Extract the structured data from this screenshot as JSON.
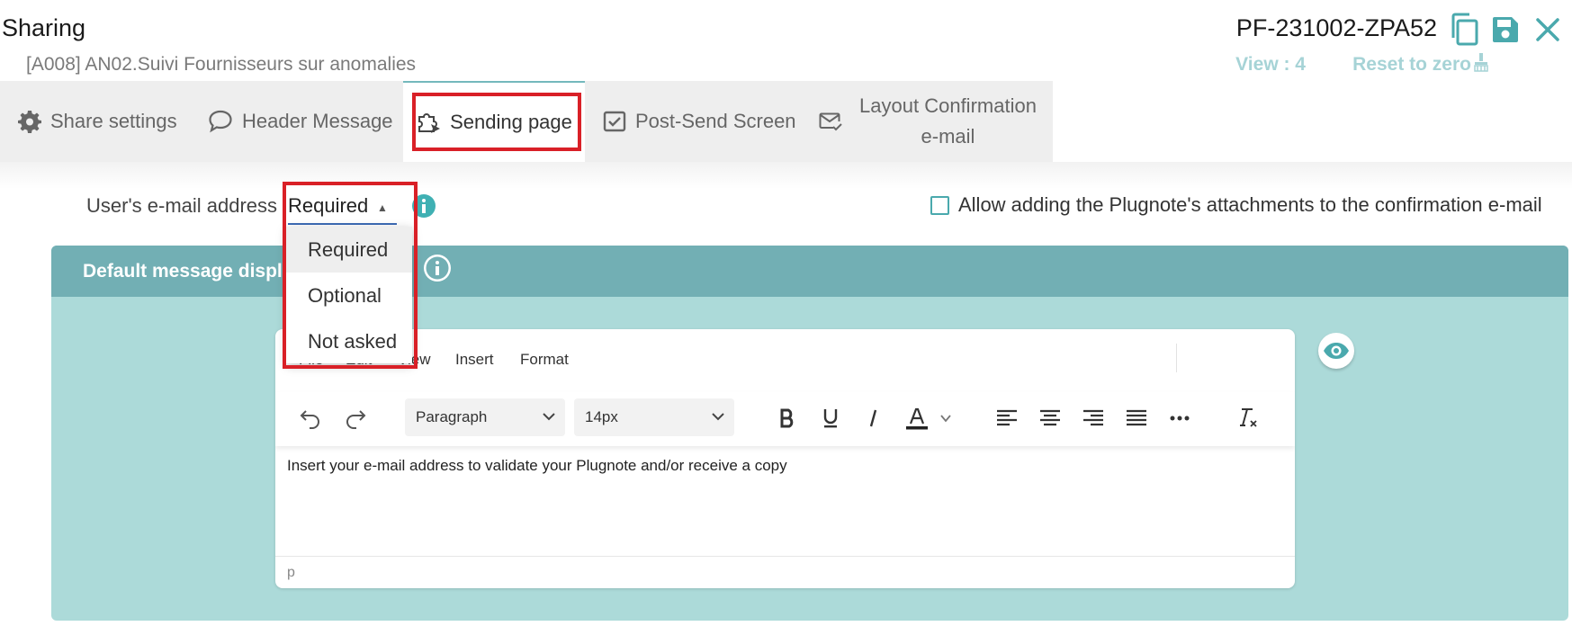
{
  "header": {
    "title": "Sharing",
    "subtitle": "[A008] AN02.Suivi Fournisseurs sur anomalies",
    "plugnote_code": "PF-231002-ZPA52",
    "view_count": "View : 4",
    "reset_label": "Reset to zero"
  },
  "tabs": [
    {
      "label": "Share settings",
      "icon": "gear-icon"
    },
    {
      "label": "Header Message",
      "icon": "speech-bubble-icon"
    },
    {
      "label": "Sending page",
      "icon": "puzzle-send-icon",
      "active": true
    },
    {
      "label": "Post-Send Screen",
      "icon": "checkbox-icon"
    },
    {
      "label_line1": "Layout Confirmation",
      "label_line2": "e-mail",
      "icon": "envelope-check-icon"
    }
  ],
  "email_setting": {
    "label": "User's e-mail address",
    "selected": "Required",
    "options": [
      "Required",
      "Optional",
      "Not asked"
    ]
  },
  "attachments_checkbox": {
    "label": "Allow adding the Plugnote's attachments to the confirmation e-mail",
    "checked": false
  },
  "panel": {
    "title": "Default message displ"
  },
  "editor": {
    "menu": [
      "File",
      "Edit",
      "View",
      "Insert",
      "Format"
    ],
    "block_format": "Paragraph",
    "font_size": "14px",
    "content": "Insert your e-mail address to validate your Plugnote and/or receive a copy",
    "status_path": "p"
  },
  "colors": {
    "accent": "#74b8bc",
    "panel_bg": "#acdad9",
    "panel_header": "#72afb4",
    "highlight": "#d92027",
    "select_underline": "#3d6bb5"
  }
}
